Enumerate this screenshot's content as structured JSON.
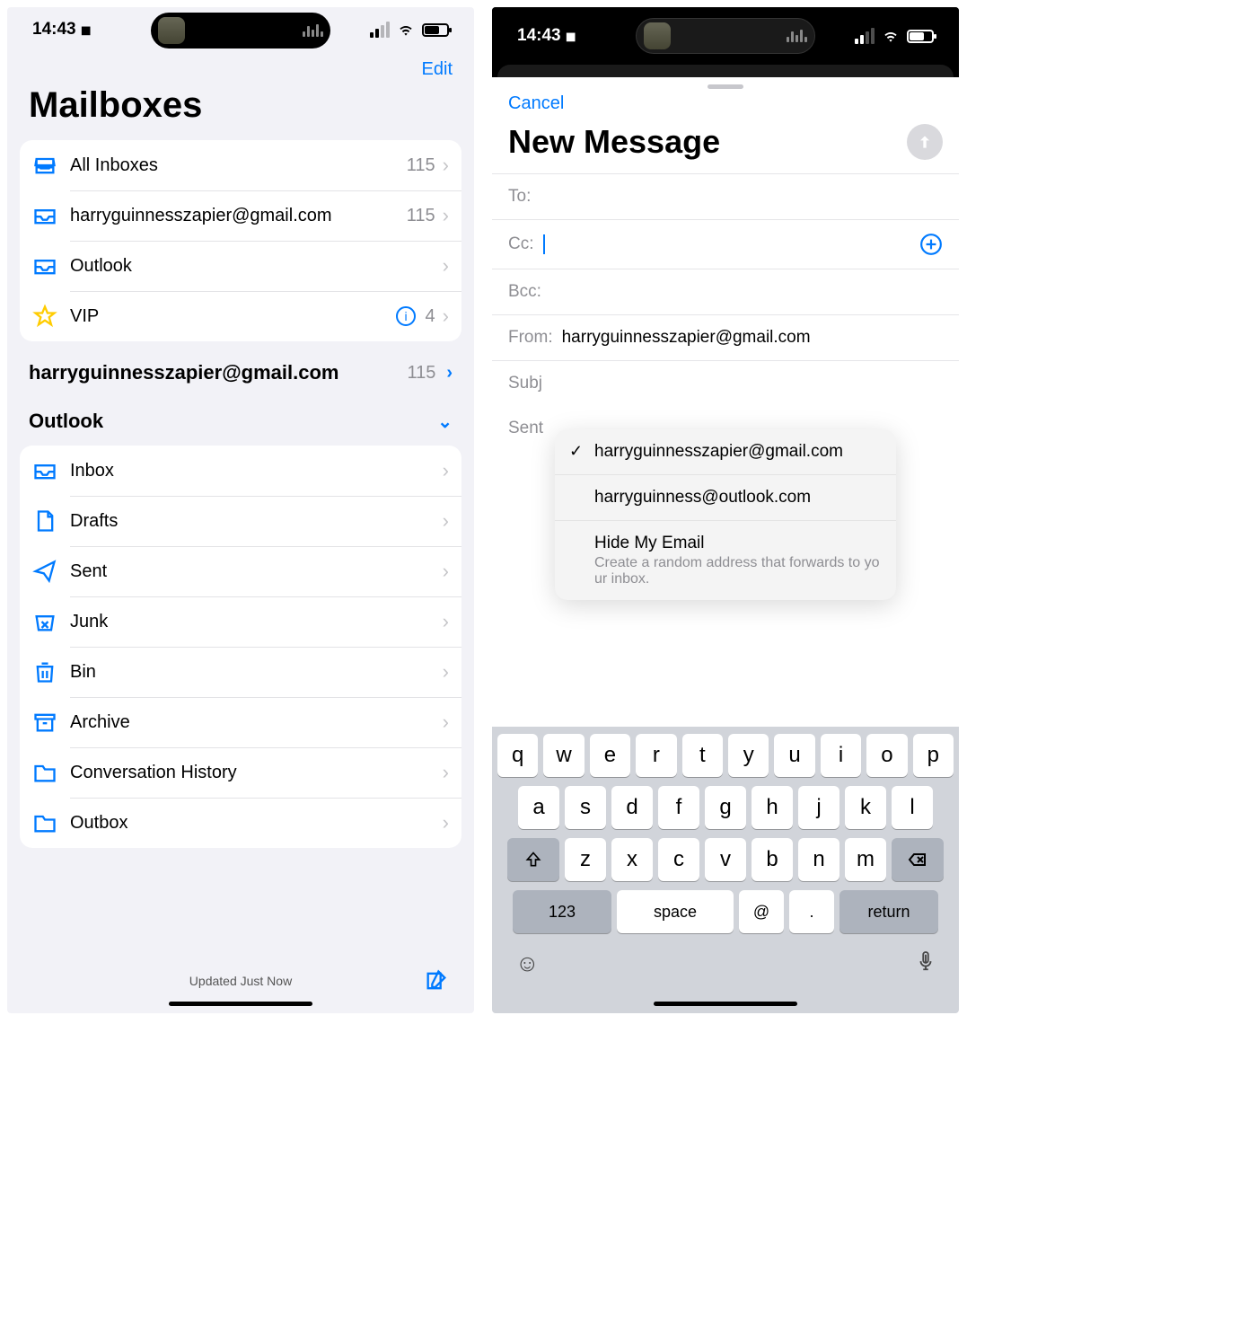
{
  "left": {
    "status": {
      "time": "14:43"
    },
    "edit": "Edit",
    "title": "Mailboxes",
    "top_mailboxes": [
      {
        "icon": "stacked-inbox",
        "label": "All Inboxes",
        "count": "115"
      },
      {
        "icon": "inbox",
        "label": "harryguinnesszapier@gmail.com",
        "count": "115"
      },
      {
        "icon": "inbox",
        "label": "Outlook",
        "count": ""
      },
      {
        "icon": "star",
        "label": "VIP",
        "count": "4",
        "info": true
      }
    ],
    "sections": [
      {
        "label": "harryguinnesszapier@gmail.com",
        "count": "115",
        "chev": "right"
      },
      {
        "label": "Outlook",
        "count": "",
        "chev": "down"
      }
    ],
    "outlook_folders": [
      {
        "icon": "inbox",
        "label": "Inbox"
      },
      {
        "icon": "doc",
        "label": "Drafts"
      },
      {
        "icon": "send",
        "label": "Sent"
      },
      {
        "icon": "junk",
        "label": "Junk"
      },
      {
        "icon": "trash",
        "label": "Bin"
      },
      {
        "icon": "archive",
        "label": "Archive"
      },
      {
        "icon": "folder",
        "label": "Conversation History"
      },
      {
        "icon": "folder",
        "label": "Outbox"
      }
    ],
    "footer_status": "Updated Just Now"
  },
  "right": {
    "status": {
      "time": "14:43"
    },
    "cancel": "Cancel",
    "title": "New Message",
    "fields": {
      "to_label": "To:",
      "cc_label": "Cc:",
      "bcc_label": "Bcc:",
      "from_label": "From:",
      "from_value": "harryguinnesszapier@gmail.com",
      "subject_label_visible": "Subj",
      "body_visible": "Sent"
    },
    "from_menu": [
      {
        "label": "harryguinnesszapier@gmail.com",
        "selected": true
      },
      {
        "label": "harryguinness@outlook.com",
        "selected": false
      },
      {
        "label": "Hide My Email",
        "sub": "Create a random address that forwards to your inbox.",
        "selected": false
      }
    ],
    "keyboard": {
      "row1": [
        "q",
        "w",
        "e",
        "r",
        "t",
        "y",
        "u",
        "i",
        "o",
        "p"
      ],
      "row2": [
        "a",
        "s",
        "d",
        "f",
        "g",
        "h",
        "j",
        "k",
        "l"
      ],
      "row3": [
        "z",
        "x",
        "c",
        "v",
        "b",
        "n",
        "m"
      ],
      "bottom": {
        "num": "123",
        "space": "space",
        "at": "@",
        "dot": ".",
        "ret": "return"
      }
    }
  }
}
